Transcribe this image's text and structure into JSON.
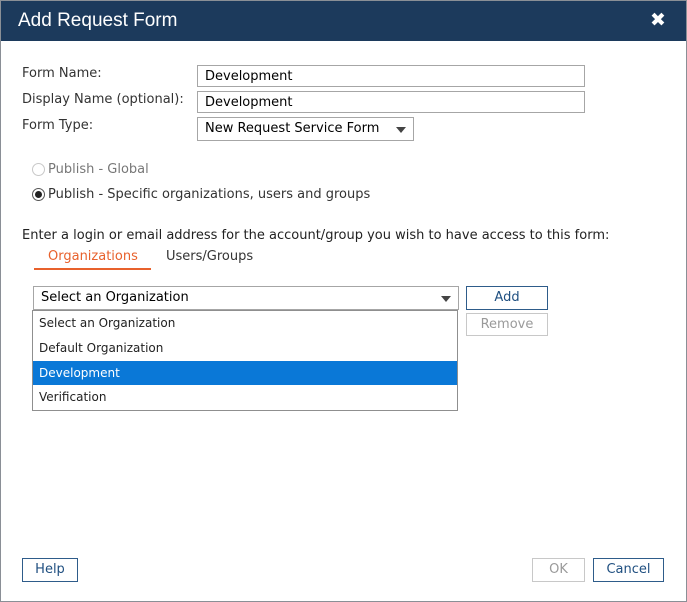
{
  "dialog": {
    "title": "Add Request Form",
    "close_icon": "close-icon"
  },
  "form": {
    "name_label": "Form Name:",
    "name_value": "Development",
    "display_name_label": "Display Name (optional):",
    "display_name_value": "Development",
    "type_label": "Form Type:",
    "type_value": "New Request Service Form"
  },
  "publish": {
    "global_label": "Publish - Global",
    "specific_label": "Publish - Specific organizations, users and groups",
    "selected": "specific"
  },
  "access": {
    "instruction": "Enter a login or email address for the account/group you wish to have access to this form:",
    "tabs": [
      {
        "label": "Organizations",
        "active": true
      },
      {
        "label": "Users/Groups",
        "active": false
      }
    ],
    "org_select_value": "Select an Organization",
    "options": [
      {
        "label": "Select an Organization",
        "selected": false
      },
      {
        "label": "Default Organization",
        "selected": false
      },
      {
        "label": "Development",
        "selected": true
      },
      {
        "label": "Verification",
        "selected": false
      }
    ],
    "add_label": "Add",
    "remove_label": "Remove"
  },
  "footer": {
    "help_label": "Help",
    "ok_label": "OK",
    "cancel_label": "Cancel"
  },
  "colors": {
    "titlebar": "#1c3a5c",
    "accent": "#e8612c",
    "selection": "#0a78d7",
    "button_border": "#2e5c8a"
  }
}
